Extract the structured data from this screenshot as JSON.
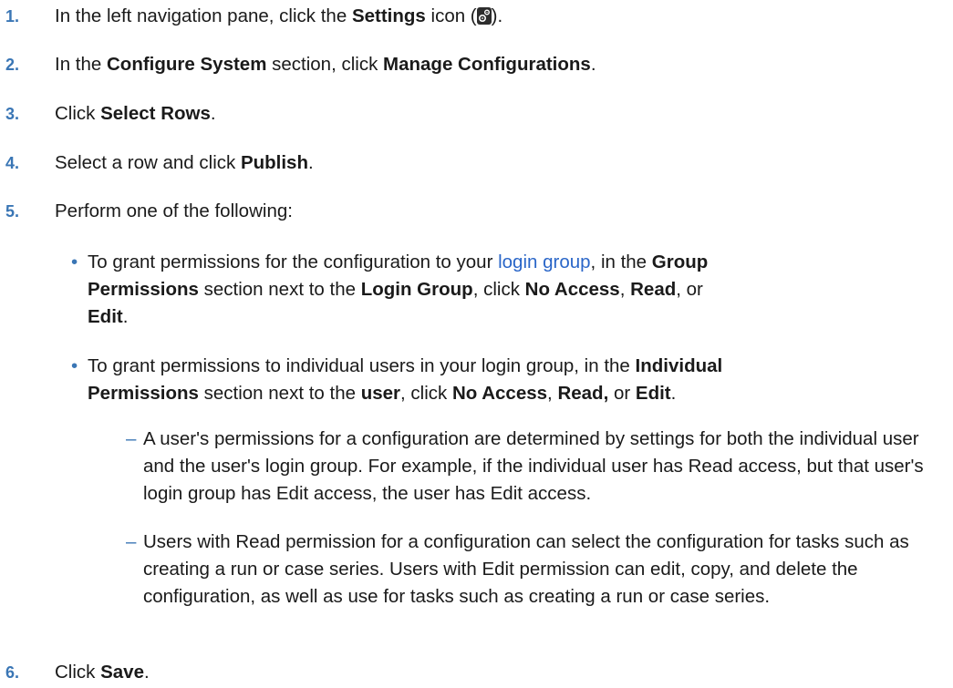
{
  "steps": [
    {
      "number": "1.",
      "before": "In the left navigation pane, click the ",
      "bold": "Settings",
      "after": " icon (",
      "end": ").",
      "icon": "settings-gear-icon"
    },
    {
      "number": "2.",
      "before": "In the ",
      "bold1": "Configure System",
      "middle": " section, click ",
      "bold2": "Manage Configurations",
      "end": "."
    },
    {
      "number": "3.",
      "before": "Click ",
      "bold": "Select Rows",
      "end": "."
    },
    {
      "number": "4.",
      "before": "Select a row and click ",
      "bold": "Publish",
      "end": "."
    },
    {
      "number": "5.",
      "text": "Perform one of the following:",
      "bullets": [
        {
          "mark": "•",
          "t1": "To grant permissions for the configuration to your ",
          "link": "login group",
          "t2": ", in the ",
          "b1": "Group",
          "b1b": "Permissions",
          "t3": " section next to the ",
          "b2": "Login Group",
          "t4": ", click ",
          "b3": "No Access",
          "t5": ", ",
          "b4": "Read",
          "t6": ", or",
          "b5": "Edit",
          "t7": "."
        },
        {
          "mark": "•",
          "t1": "To grant permissions to individual users in your login group, in the ",
          "b1": "Individual",
          "b1b": "Permissions",
          "t2": " section next to the ",
          "b2": "user",
          "t3": ", click ",
          "b3": "No Access",
          "t4": ", ",
          "b4": "Read,",
          "t5": " or ",
          "b5": "Edit",
          "t6": ".",
          "notes": [
            {
              "mark": "–",
              "lines": [
                "A user's permissions for a configuration are determined by settings for",
                "both the individual user and the user's login group. For example, if the",
                "individual user has Read access, but that user's login group has Edit",
                "access, the user has Edit access."
              ]
            },
            {
              "mark": "–",
              "lines": [
                "Users with Read permission for a configuration can select the",
                "configuration for tasks such as creating a run or case series. Users with",
                "Edit permission can edit, copy, and delete the configuration, as well as use",
                "for tasks such as creating a run or case series."
              ]
            }
          ]
        }
      ]
    },
    {
      "number": "6.",
      "before": "Click ",
      "bold": "Save",
      "end": "."
    }
  ]
}
